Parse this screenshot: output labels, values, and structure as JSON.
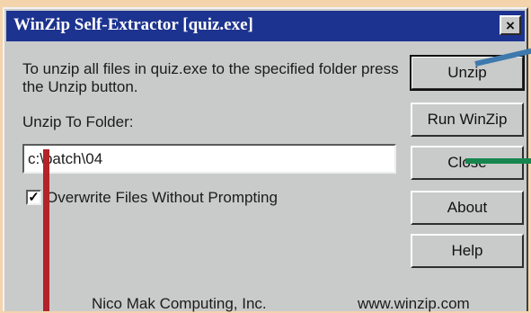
{
  "window": {
    "title": "WinZip Self-Extractor [quiz.exe]",
    "close_glyph": "×"
  },
  "instructions": "To unzip all files in quiz.exe to the specified folder press the Unzip button.",
  "folder": {
    "label": "Unzip To Folder:",
    "value": "c:\\patch\\04"
  },
  "overwrite": {
    "checked_glyph": "✓",
    "label": "Overwrite Files Without Prompting"
  },
  "buttons": {
    "unzip": "Unzip",
    "run_winzip": "Run WinZip",
    "close": "Close",
    "about": "About",
    "help": "Help"
  },
  "footer": {
    "company": "Nico Mak Computing, Inc.",
    "website": "www.winzip.com"
  },
  "colors": {
    "titlebar": "#1d3390",
    "face": "#c9cbca",
    "background": "#f3d4ad",
    "annotation_red": "#b3232a",
    "annotation_blue": "#3e79ad",
    "annotation_green": "#16864e"
  }
}
